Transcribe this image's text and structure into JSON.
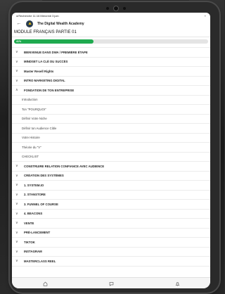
{
  "status": {
    "left": "◂ Recherche  11:16  Mercredi 3 juin",
    "right": "⌁"
  },
  "app": {
    "title": "The Digital Wealth Academy"
  },
  "module": {
    "title": "MODULE FRANÇAIS PARTIE 01",
    "progress_label": "41%",
    "progress_fraction": 0.41
  },
  "outline": [
    {
      "label": "BIENVENUE DANS DWA / PREMIÈRE ÉTAPE"
    },
    {
      "label": "MINDSET LA CLÉ DU SUCCÈS"
    },
    {
      "label": "Master Resell Rights"
    },
    {
      "label": "INTRO MARKETING DIGITAL"
    },
    {
      "label": "FONDATION DE TON ENTREPRISE",
      "expanded": true
    },
    {
      "label": "Introduction",
      "lesson": true
    },
    {
      "label": "Ton \"POURQUOI\"",
      "lesson": true
    },
    {
      "label": "Définir Votre Niche",
      "lesson": true
    },
    {
      "label": "Définir ton Audience Cible",
      "lesson": true
    },
    {
      "label": "Votre Histoire",
      "lesson": true
    },
    {
      "label": "Théorie du \"V\"",
      "lesson": true
    },
    {
      "label": "CHECKLIST",
      "lesson": true
    },
    {
      "label": "CONSTRUIRE RELATION CONFIANCE AVEC AUDIENCE"
    },
    {
      "label": "CRÉATION DES SYSTÈMES"
    },
    {
      "label": "1. SYSTEM.IO"
    },
    {
      "label": "2. STANSTORE"
    },
    {
      "label": "3. FUNNEL OF COURSE"
    },
    {
      "label": "4. BEACONS"
    },
    {
      "label": "VENTE"
    },
    {
      "label": "PRÉ-LANCEMENT"
    },
    {
      "label": "TIKTOK"
    },
    {
      "label": "INSTAGRAM"
    },
    {
      "label": "MASTERCLASS REEL"
    }
  ],
  "nav": {
    "icons": [
      "home-icon",
      "chat-icon",
      "bell-icon"
    ]
  },
  "colors": {
    "accent": "#1faa4f",
    "logo_bg": "#2c3e50"
  }
}
